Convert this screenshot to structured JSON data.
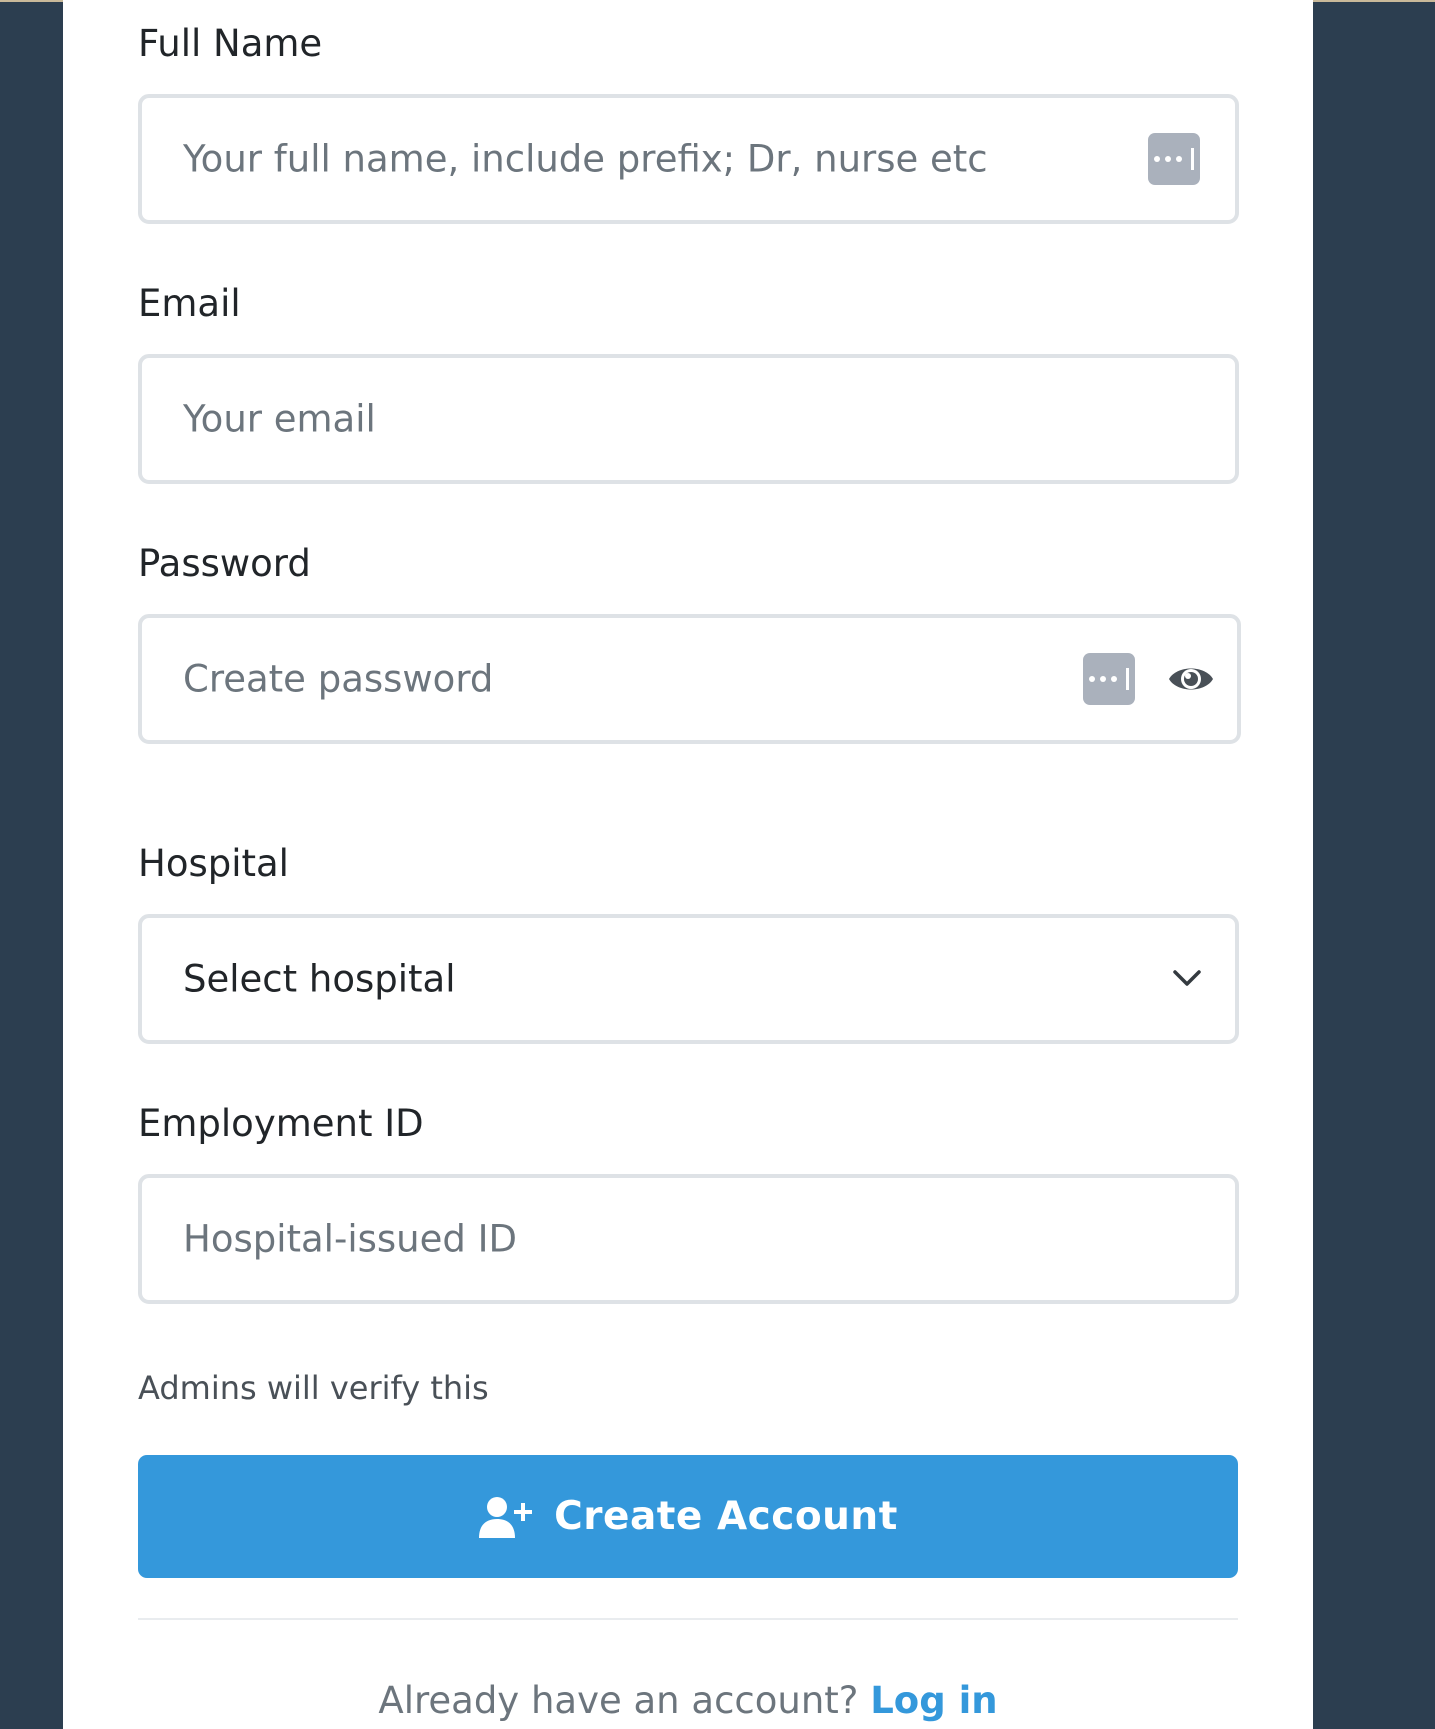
{
  "form": {
    "full_name": {
      "label": "Full Name",
      "placeholder": "Your full name, include prefix; Dr, nurse etc"
    },
    "email": {
      "label": "Email",
      "placeholder": "Your email"
    },
    "password": {
      "label": "Password",
      "placeholder": "Create password"
    },
    "hospital": {
      "label": "Hospital",
      "selected": "Select hospital"
    },
    "employment_id": {
      "label": "Employment ID",
      "placeholder": "Hospital-issued ID",
      "hint": "Admins will verify this"
    },
    "submit_label": "Create Account"
  },
  "footer": {
    "prompt": "Already have an account?",
    "link": "Log in"
  },
  "icons": {
    "autofill": "password-manager-icon",
    "eye": "eye-icon",
    "chevron": "chevron-down-icon",
    "user_add": "user-plus-icon"
  },
  "colors": {
    "background": "#2c3e50",
    "accent": "#3498db",
    "border": "#dee2e6"
  }
}
